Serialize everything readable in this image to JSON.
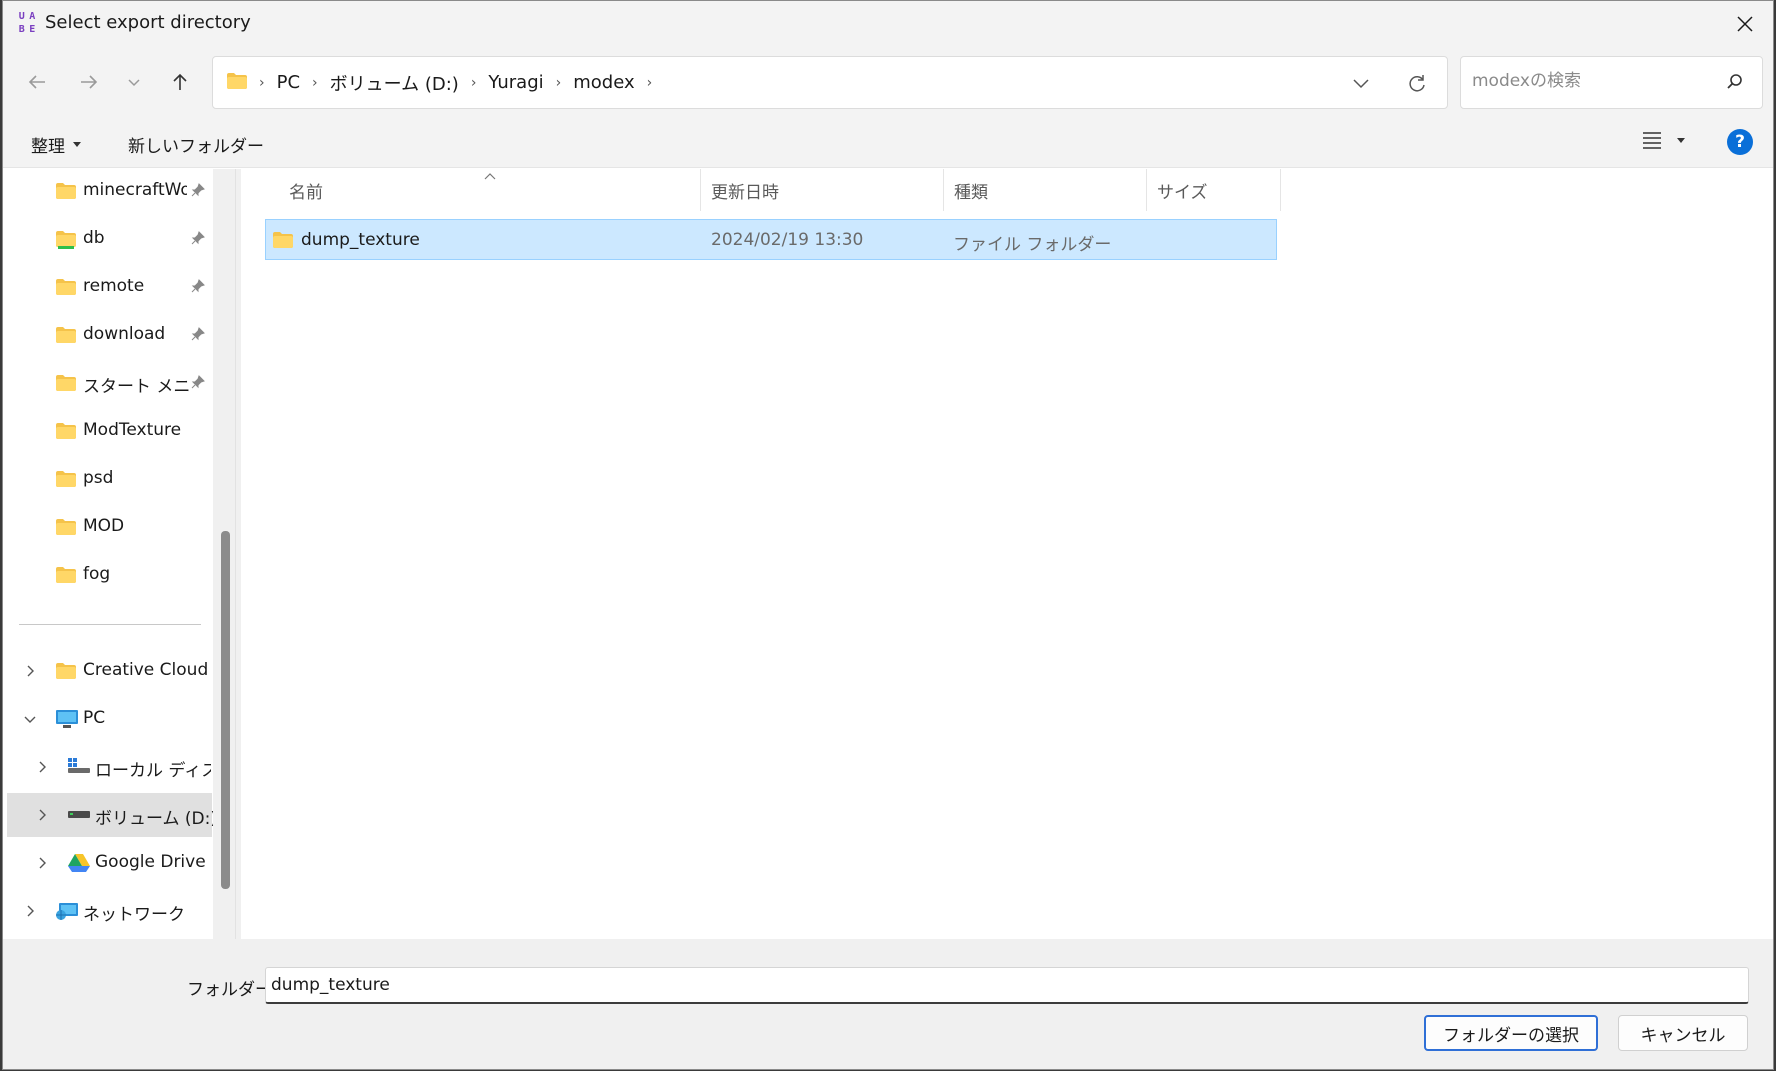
{
  "window": {
    "title": "Select export directory",
    "app_icon_letters": [
      "U",
      "A",
      "B",
      "E"
    ],
    "accent": "#0a6fd8"
  },
  "navbar": {
    "back_icon": "arrow-left-icon",
    "forward_icon": "arrow-right-icon",
    "recent_icon": "chevron-down-icon",
    "up_icon": "arrow-up-icon",
    "breadcrumbs": [
      "PC",
      "ボリューム (D:)",
      "Yuragi",
      "modex"
    ],
    "search_placeholder": "modexの検索"
  },
  "commandbar": {
    "organize": "整理",
    "new_folder": "新しいフォルダー",
    "help": "?"
  },
  "sidebar": {
    "quick_access": [
      {
        "label": "minecraftWorld",
        "icon": "folder-icon",
        "pinned": true
      },
      {
        "label": "db",
        "icon": "folder-icon",
        "pinned": true
      },
      {
        "label": "remote",
        "icon": "folder-icon",
        "pinned": true
      },
      {
        "label": "download",
        "icon": "folder-icon",
        "pinned": true
      },
      {
        "label": "スタート メニュー",
        "icon": "folder-icon",
        "pinned": true
      },
      {
        "label": "ModTexture",
        "icon": "folder-icon",
        "pinned": false
      },
      {
        "label": "psd",
        "icon": "folder-icon",
        "pinned": false
      },
      {
        "label": "MOD",
        "icon": "folder-icon",
        "pinned": false
      },
      {
        "label": "fog",
        "icon": "folder-icon",
        "pinned": false
      }
    ],
    "tree": [
      {
        "label": "Creative Cloud Files",
        "icon": "folder-icon"
      },
      {
        "label": "PC",
        "icon": "computer-icon"
      },
      {
        "label": "ローカル ディスク (C:)",
        "icon": "windows-drive-icon"
      },
      {
        "label": "ボリューム (D:)",
        "icon": "drive-icon"
      },
      {
        "label": "Google Drive (G:)",
        "icon": "google-drive-icon"
      },
      {
        "label": "ネットワーク",
        "icon": "network-icon"
      }
    ]
  },
  "filelist": {
    "columns": [
      "名前",
      "更新日時",
      "種類",
      "サイズ"
    ],
    "rows": [
      {
        "name": "dump_texture",
        "modified": "2024/02/19 13:30",
        "type": "ファイル フォルダー",
        "size": ""
      }
    ]
  },
  "footer": {
    "folder_label": "フォルダー:",
    "folder_value": "dump_texture",
    "select_button": "フォルダーの選択",
    "cancel_button": "キャンセル"
  }
}
